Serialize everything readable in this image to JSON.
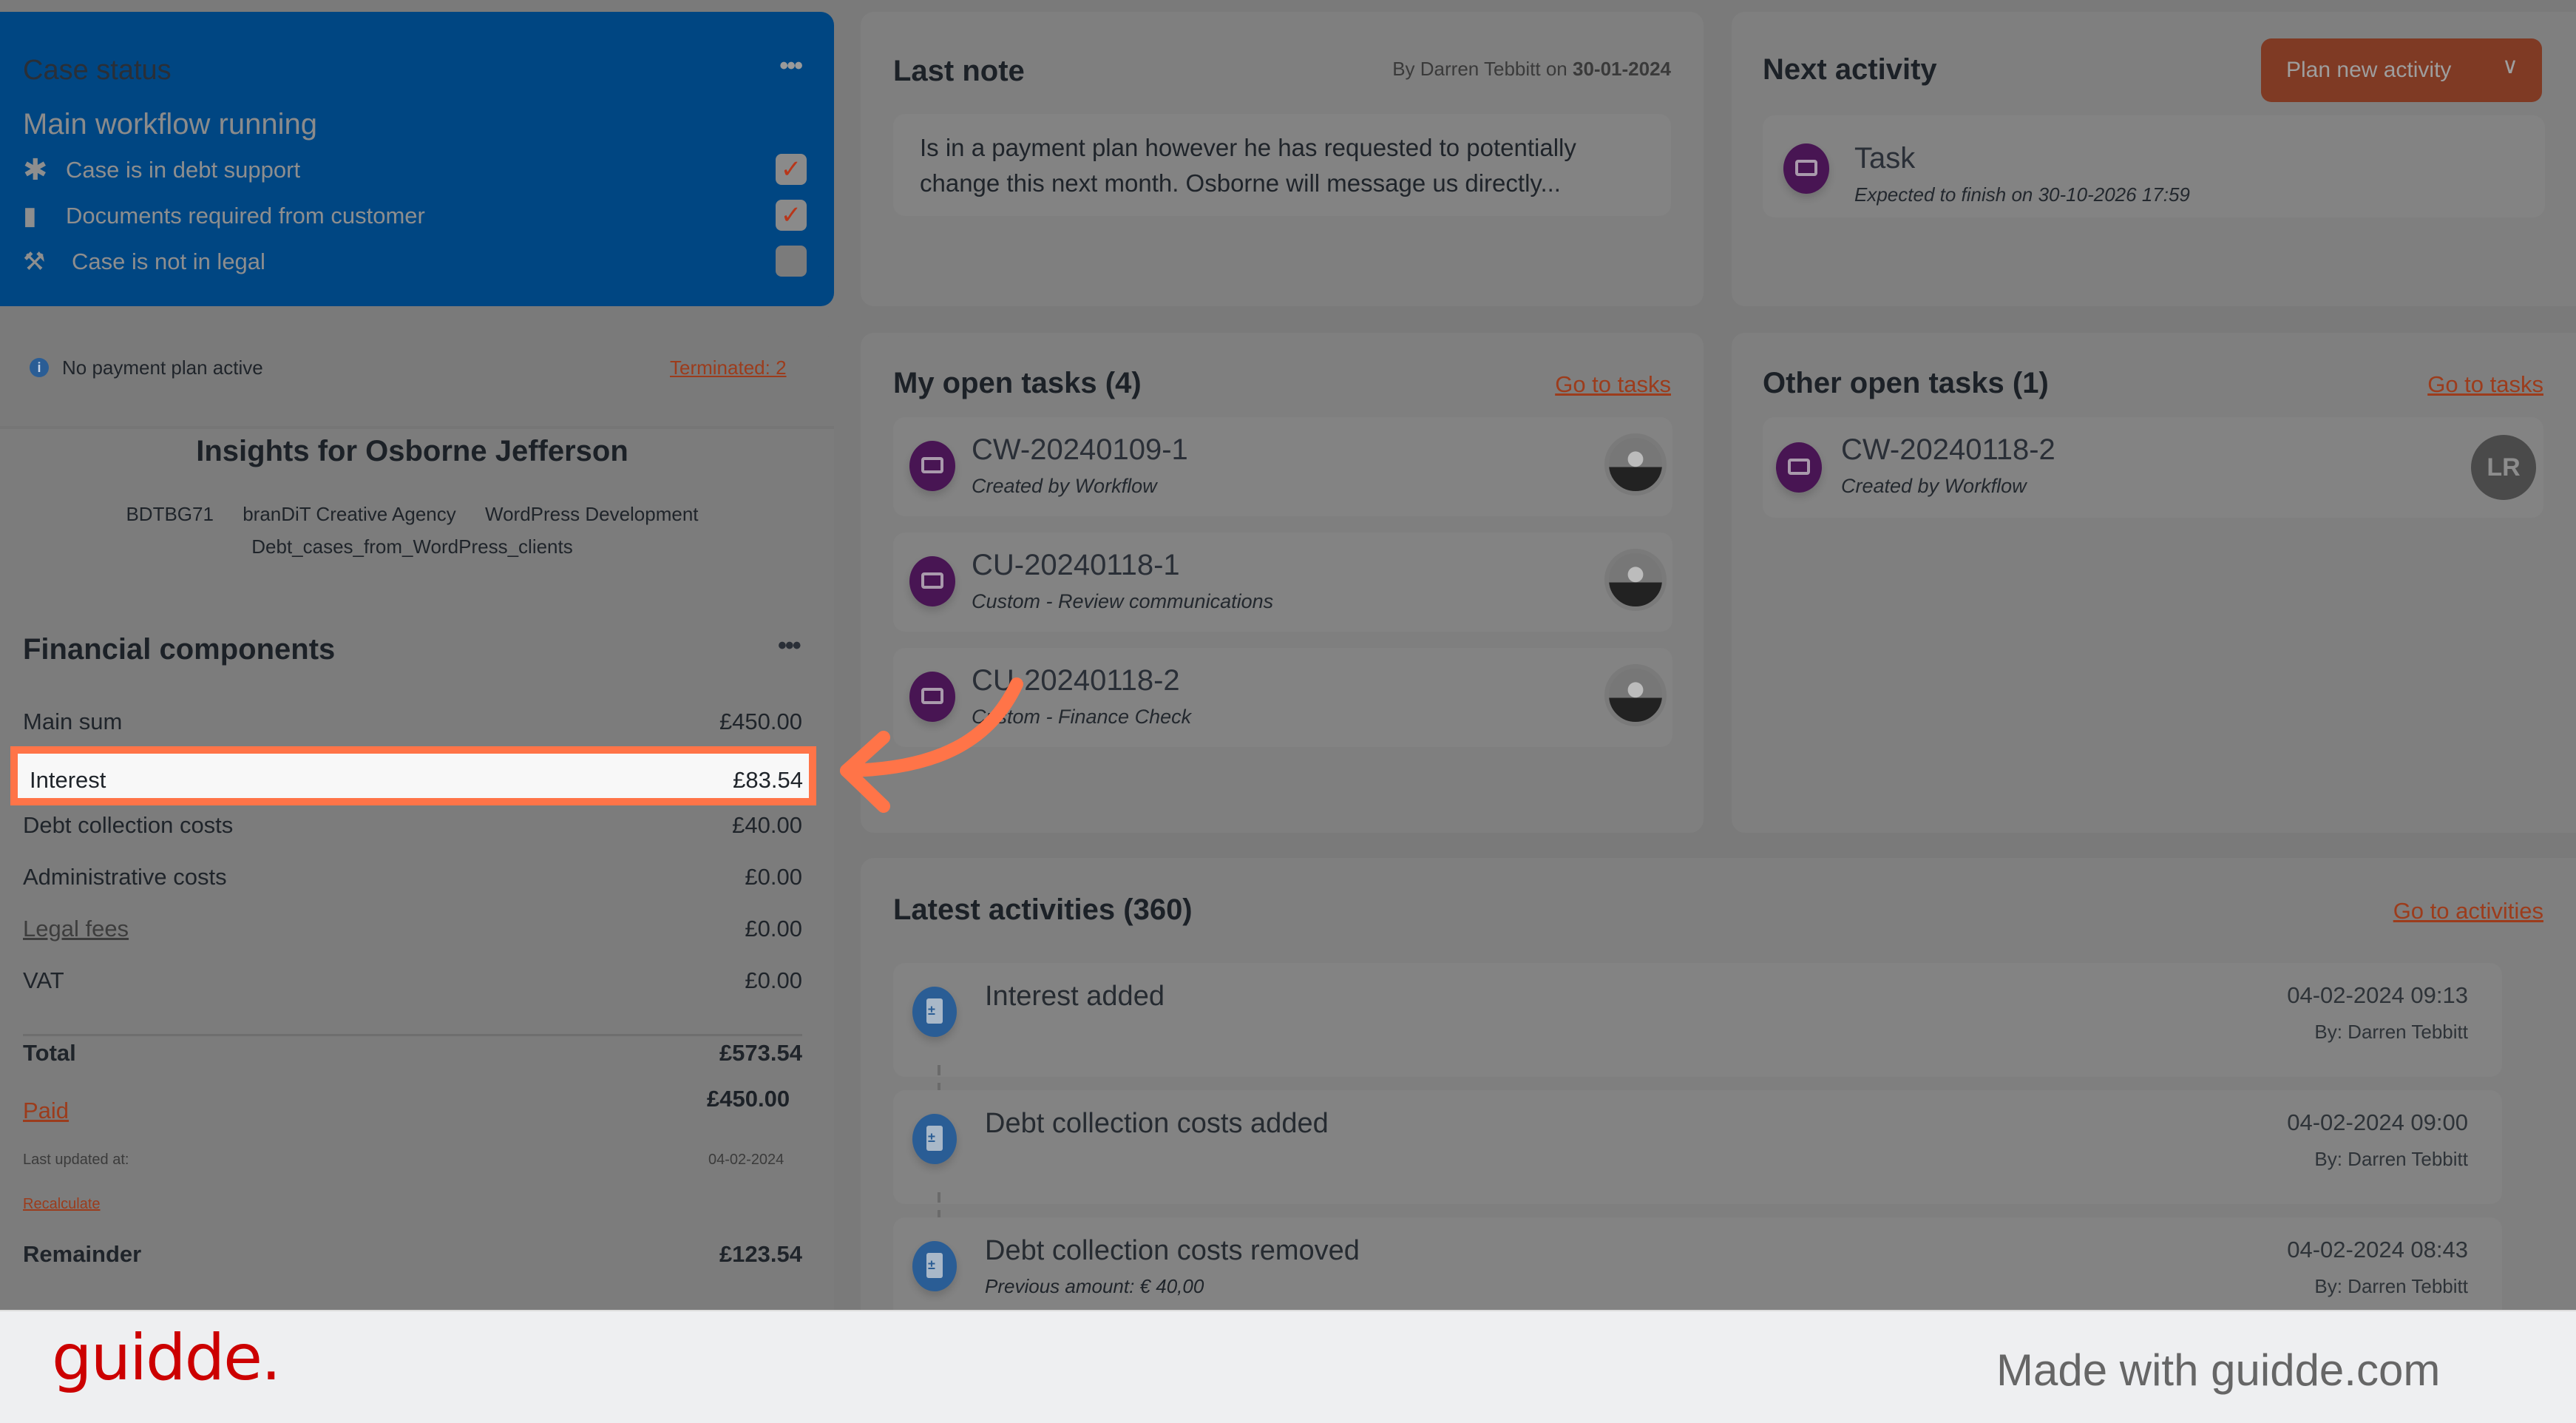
{
  "case_status": {
    "title": "Case status",
    "subtitle": "Main workflow running",
    "menu_icon": "more-dots-icon",
    "items": [
      {
        "icon": "asterisk-icon",
        "label": "Case is in debt support",
        "checked": true
      },
      {
        "icon": "document-icon",
        "label": "Documents required from customer",
        "checked": true
      },
      {
        "icon": "gavel-icon",
        "label": "Case is not in legal",
        "checked": false
      }
    ],
    "check_glyph": "✓"
  },
  "payment_plan": {
    "status_text": "No payment plan active",
    "terminated_link": "Terminated: 2",
    "info_glyph": "i"
  },
  "insights": {
    "title": "Insights for Osborne Jefferson",
    "tags": [
      "BDTBG71",
      "branDiT Creative Agency",
      "WordPress Development"
    ],
    "tag_line2": "Debt_cases_from_WordPress_clients"
  },
  "financial": {
    "title": "Financial components",
    "menu_glyph": "•••",
    "rows": [
      {
        "label": "Main sum",
        "value": "£450.00"
      },
      {
        "label": "Interest",
        "value": "£83.54",
        "highlighted": true
      },
      {
        "label": "Debt collection costs",
        "value": "£40.00"
      },
      {
        "label": "Administrative costs",
        "value": "£0.00"
      },
      {
        "label": "Legal fees",
        "value": "£0.00",
        "link": true
      },
      {
        "label": "VAT",
        "value": "£0.00"
      }
    ],
    "total_label": "Total",
    "total_value": "£573.54",
    "paid_label": "Paid",
    "paid_value": "£450.00",
    "last_updated_label": "Last updated at:",
    "last_updated_value": "04-02-2024",
    "recalculate_label": "Recalculate",
    "remainder_label": "Remainder",
    "remainder_value": "£123.54"
  },
  "last_note": {
    "title": "Last note",
    "by_prefix": "By Darren Tebbitt on",
    "date": "30-01-2024",
    "text": "Is in a payment plan however he has requested to potentially change this next month. Osborne will message us directly..."
  },
  "next_activity": {
    "title": "Next activity",
    "plan_button": "Plan new activity",
    "chevron": "∨",
    "task_title": "Task",
    "task_subtitle": "Expected to finish on 30-10-2026 17:59"
  },
  "my_tasks": {
    "title": "My open tasks (4)",
    "link": "Go to tasks",
    "items": [
      {
        "id": "CW-20240109-1",
        "subtitle": "Created by Workflow"
      },
      {
        "id": "CU-20240118-1",
        "subtitle": "Custom - Review communications"
      },
      {
        "id": "CU-20240118-2",
        "subtitle": "Custom - Finance Check"
      }
    ]
  },
  "other_tasks": {
    "title": "Other open tasks (1)",
    "link": "Go to tasks",
    "items": [
      {
        "id": "CW-20240118-2",
        "subtitle": "Created by Workflow",
        "avatar_initials": "LR"
      }
    ]
  },
  "latest_activities": {
    "title": "Latest activities (360)",
    "link": "Go to activities",
    "items": [
      {
        "title": "Interest added",
        "date": "04-02-2024 09:13",
        "by": "By: Darren Tebbitt"
      },
      {
        "title": "Debt collection costs added",
        "date": "04-02-2024 09:00",
        "by": "By: Darren Tebbitt"
      },
      {
        "title": "Debt collection costs removed",
        "date": "04-02-2024 08:43",
        "by": "By: Darren Tebbitt",
        "detail": "Previous amount: € 40,00"
      }
    ]
  },
  "footer": {
    "logo": "guidde.",
    "tagline": "Made with guidde.com"
  },
  "colors": {
    "case_status_bg": "#004682",
    "highlight_border": "#ff7448",
    "link": "#9c3c1c",
    "task_icon": "#481553",
    "activity_icon": "#2a5d95",
    "guidde_red": "#cc0000"
  }
}
